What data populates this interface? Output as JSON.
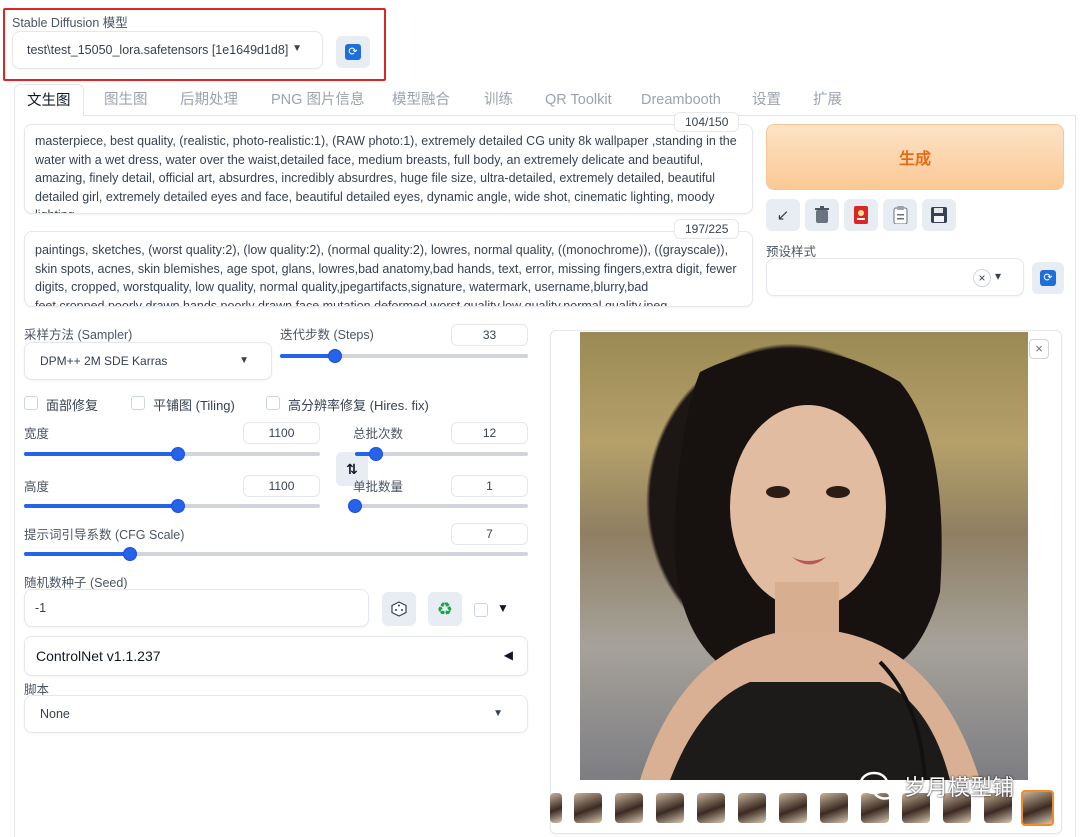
{
  "model": {
    "label": "Stable Diffusion 模型",
    "selected": "test\\test_15050_lora.safetensors [1e1649d1d8]"
  },
  "tabs": [
    "文生图",
    "图生图",
    "后期处理",
    "PNG 图片信息",
    "模型融合",
    "训练",
    "QR Toolkit",
    "Dreambooth",
    "设置",
    "扩展"
  ],
  "prompt": {
    "counter": "104/150",
    "text": "masterpiece, best quality, (realistic, photo-realistic:1), (RAW photo:1), extremely detailed CG unity 8k wallpaper ,standing in the water with a wet dress, water over the waist,detailed face, medium breasts, full body, an extremely delicate and beautiful, amazing, finely detail, official art, absurdres, incredibly absurdres, huge file size, ultra-detailed, extremely detailed, beautiful detailed girl, extremely detailed eyes and face, beautiful detailed eyes, dynamic angle, wide shot, cinematic lighting, moody lighting,"
  },
  "negative_prompt": {
    "counter": "197/225",
    "text": "paintings, sketches, (worst quality:2), (low quality:2), (normal quality:2), lowres, normal quality, ((monochrome)), ((grayscale)), skin spots, acnes, skin blemishes, age spot, glans, lowres,bad anatomy,bad hands, text, error, missing fingers,extra digit, fewer digits, cropped, worstquality, low quality, normal quality,jpegartifacts,signature, watermark, username,blurry,bad feet,cropped,poorly drawn hands,poorly drawn face,mutation,deformed,worst quality,low quality,normal quality,jpeg"
  },
  "generate": {
    "label": "生成",
    "accent": "#f28c28"
  },
  "styles": {
    "label": "预设样式",
    "clear": "×",
    "arrow": "▾"
  },
  "sampler": {
    "label": "采样方法 (Sampler)",
    "value": "DPM++ 2M SDE Karras"
  },
  "steps": {
    "label": "迭代步数 (Steps)",
    "value": "33",
    "fraction": 0.22
  },
  "checks": {
    "face": "面部修复",
    "tiling": "平铺图 (Tiling)",
    "hires": "高分辨率修复 (Hires. fix)"
  },
  "width": {
    "label": "宽度",
    "value": "1100",
    "fraction": 0.52
  },
  "height": {
    "label": "高度",
    "value": "1100",
    "fraction": 0.52
  },
  "batch_count": {
    "label": "总批次数",
    "value": "12",
    "fraction": 0.12
  },
  "batch_size": {
    "label": "单批数量",
    "value": "1",
    "fraction": 0.0
  },
  "cfg": {
    "label": "提示词引导系数 (CFG Scale)",
    "value": "7",
    "fraction": 0.21
  },
  "seed": {
    "label": "随机数种子 (Seed)",
    "value": "-1"
  },
  "controlnet": {
    "label": "ControlNet v1.1.237"
  },
  "script": {
    "label": "脚本",
    "value": "None"
  },
  "watermark": {
    "text": "岁月模型铺"
  },
  "icons": {
    "refresh": "refresh-icon",
    "read": "arrow-icon",
    "trash": "trash-icon",
    "card": "red-card-icon",
    "clipboard": "clipboard-icon",
    "save": "save-icon",
    "dice": "dice-icon",
    "recycle": "recycle-icon",
    "swap": "swap-icon",
    "close": "close-icon"
  }
}
